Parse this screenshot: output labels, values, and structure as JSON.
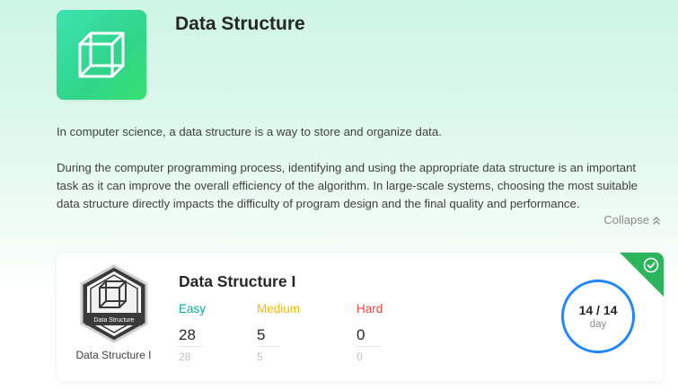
{
  "header": {
    "title": "Data Structure",
    "icon": "cube-icon",
    "colors": {
      "start": "#3ee2b0",
      "end": "#38e06f"
    }
  },
  "description": {
    "paragraph1": "In computer science, a data structure is a way to store and organize data.",
    "paragraph2": "During the computer programming process, identifying and using the appropriate data structure is an important task as it can improve the overall efficiency of the algorithm. In large-scale systems, choosing the most suitable data structure directly impacts the difficulty of program design and the final quality and performance.",
    "collapse_label": "Collapse"
  },
  "card": {
    "badge_text": "Data Structure",
    "badge_caption": "Data Structure I",
    "title": "Data Structure I",
    "difficulty": {
      "easy": {
        "label": "Easy",
        "count": "28",
        "total": "28",
        "color": "#00af9b"
      },
      "medium": {
        "label": "Medium",
        "count": "5",
        "total": "5",
        "color": "#ffb800"
      },
      "hard": {
        "label": "Hard",
        "count": "0",
        "total": "0",
        "color": "#ef4743"
      }
    },
    "progress": {
      "main": "14 / 14",
      "unit": "day",
      "color": "#1e86ff"
    },
    "completed": true,
    "completed_color": "#2db55d"
  }
}
